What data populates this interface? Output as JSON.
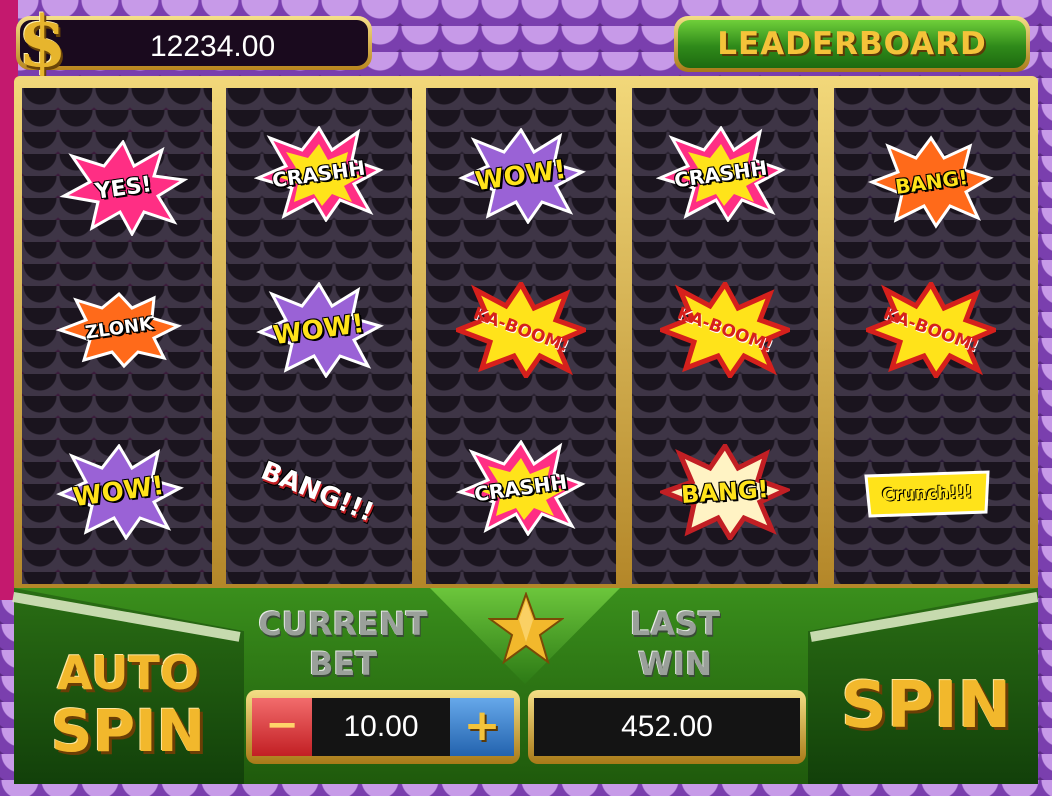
{
  "balance": {
    "icon": "dollar-icon",
    "symbol": "$",
    "value": "12234.00"
  },
  "leaderboard": {
    "label": "LEADERBOARD"
  },
  "reels": [
    [
      "YES!",
      "ZLONK",
      "WOW!"
    ],
    [
      "CRASHH",
      "WOW!",
      "BANG!!!"
    ],
    [
      "WOW!",
      "KA-BOOM!",
      "CRASHH"
    ],
    [
      "CRASHH",
      "KA-BOOM!",
      "BANG!"
    ],
    [
      "BANG!",
      "KA-BOOM!",
      "Crunch!!!"
    ]
  ],
  "controls": {
    "auto_spin_line1": "AUTO",
    "auto_spin_line2": "SPIN",
    "current_bet_line1": "CURRENT",
    "current_bet_line2": "BET",
    "bet_minus": "−",
    "bet_value": "10.00",
    "bet_plus": "+",
    "last_win_line1": "LAST",
    "last_win_line2": "WIN",
    "last_win_value": "452.00",
    "spin": "SPIN",
    "star_icon": "star-icon"
  },
  "colors": {
    "gold": "#f2b82c",
    "green": "#2f8a1a",
    "purple": "#5a2a82"
  }
}
